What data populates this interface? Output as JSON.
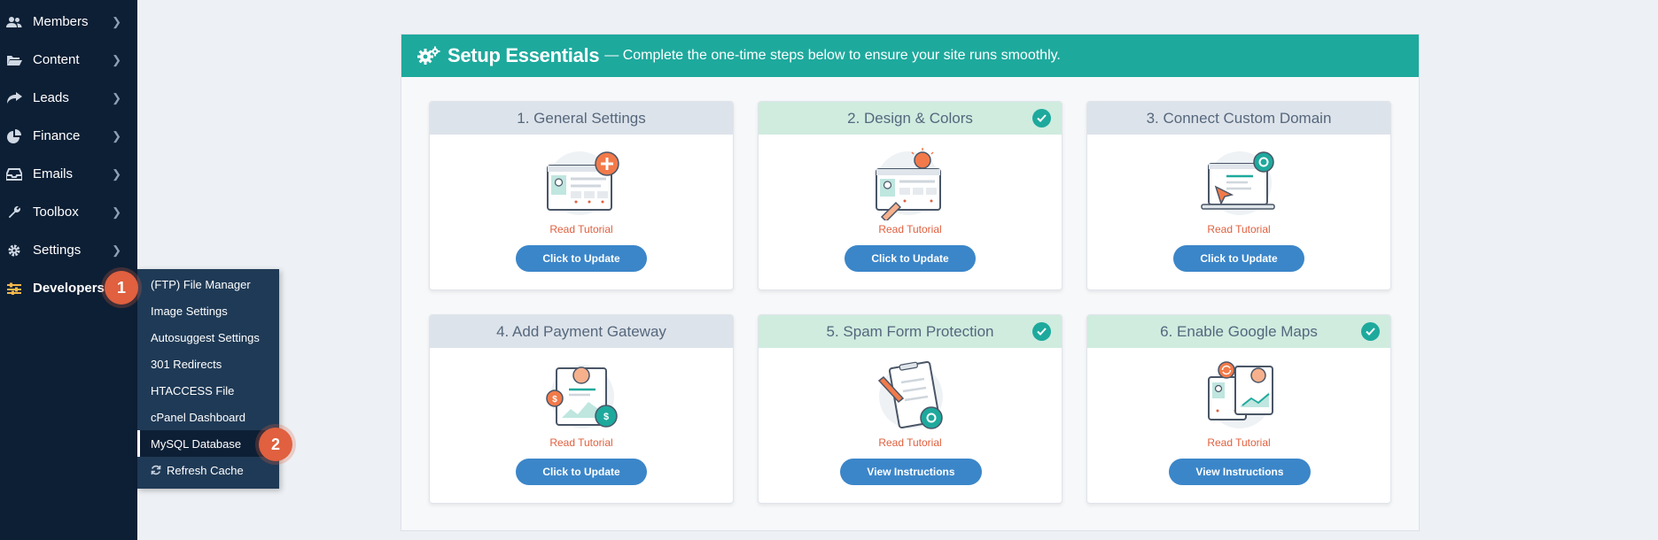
{
  "sidebar": {
    "items": [
      {
        "label": "Members",
        "icon": "users-icon"
      },
      {
        "label": "Content",
        "icon": "folder-open-icon"
      },
      {
        "label": "Leads",
        "icon": "share-icon"
      },
      {
        "label": "Finance",
        "icon": "pie-chart-icon"
      },
      {
        "label": "Emails",
        "icon": "inbox-icon"
      },
      {
        "label": "Toolbox",
        "icon": "wrench-icon"
      },
      {
        "label": "Settings",
        "icon": "gear-icon"
      },
      {
        "label": "Developers",
        "icon": "sliders-icon"
      }
    ],
    "submenu": [
      "(FTP) File Manager",
      "Image Settings",
      "Autosuggest Settings",
      "301 Redirects",
      "HTACCESS File",
      "cPanel Dashboard",
      "MySQL Database",
      "Refresh Cache"
    ],
    "badges": [
      "1",
      "2"
    ]
  },
  "panel": {
    "title": "Setup Essentials",
    "subtitle": "— Complete the one-time steps below to ensure your site runs smoothly."
  },
  "cards": [
    {
      "title": "1. General Settings",
      "done": false,
      "link": "Read Tutorial",
      "button": "Click to Update"
    },
    {
      "title": "2. Design & Colors",
      "done": true,
      "link": "Read Tutorial",
      "button": "Click to Update"
    },
    {
      "title": "3. Connect Custom Domain",
      "done": false,
      "link": "Read Tutorial",
      "button": "Click to Update"
    },
    {
      "title": "4. Add Payment Gateway",
      "done": false,
      "link": "Read Tutorial",
      "button": "Click to Update"
    },
    {
      "title": "5. Spam Form Protection",
      "done": true,
      "link": "Read Tutorial",
      "button": "View Instructions"
    },
    {
      "title": "6. Enable Google Maps",
      "done": true,
      "link": "Read Tutorial",
      "button": "View Instructions"
    }
  ],
  "colors": {
    "sidebar": "#0d1f35",
    "submenu": "#1f3a56",
    "accent_teal": "#1ea99d",
    "button_blue": "#3b86c9",
    "badge_orange": "#e0603f"
  }
}
